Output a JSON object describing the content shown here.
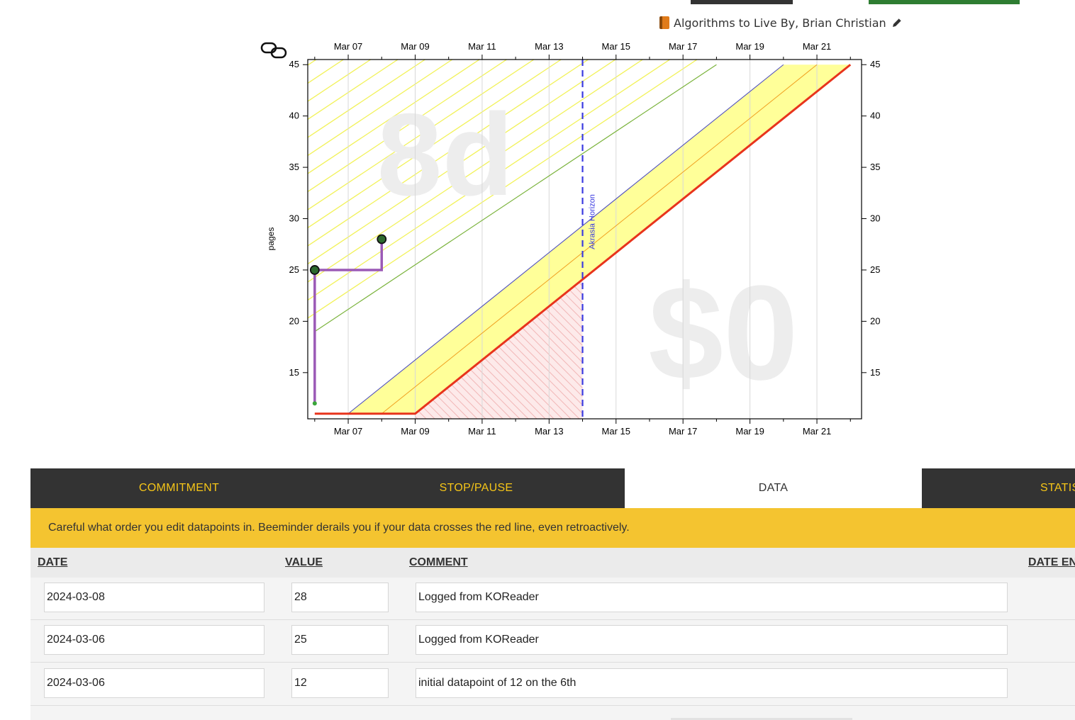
{
  "goal": {
    "book_icon": "book-icon",
    "title": "Algorithms to Live By, Brian Christian",
    "edit_icon": "pencil-icon"
  },
  "graph_controls": {
    "link_icon": "link-icon"
  },
  "chart_data": {
    "type": "line",
    "ylabel": "pages",
    "x_ticks": [
      "Mar 07",
      "Mar 09",
      "Mar 11",
      "Mar 13",
      "Mar 15",
      "Mar 17",
      "Mar 19",
      "Mar 21"
    ],
    "x_tick_dates": [
      "2024-03-07",
      "2024-03-09",
      "2024-03-11",
      "2024-03-13",
      "2024-03-15",
      "2024-03-17",
      "2024-03-19",
      "2024-03-21"
    ],
    "xlim": [
      "2024-03-05T19:00",
      "2024-03-22T08:00"
    ],
    "y_ticks": [
      15,
      20,
      25,
      30,
      35,
      40,
      45
    ],
    "ylim": [
      10.5,
      45.5
    ],
    "watermark_days": "8d",
    "watermark_pledge": "$0",
    "akrasia_horizon": {
      "label": "Akrasia Horizon",
      "date": "2024-03-14"
    },
    "bright_red_line": {
      "x": [
        "2024-03-06",
        "2024-03-09",
        "2024-03-22"
      ],
      "y": [
        11,
        11,
        45
      ]
    },
    "safe_line": {
      "x": [
        "2024-03-07",
        "2024-03-20"
      ],
      "y": [
        11,
        45
      ]
    },
    "green_line": {
      "x": [
        "2024-03-06",
        "2024-03-18"
      ],
      "y": [
        19,
        45
      ]
    },
    "datapoints": {
      "x": [
        "2024-03-06",
        "2024-03-06",
        "2024-03-08"
      ],
      "y": [
        12,
        25,
        28
      ]
    }
  },
  "tabs": [
    {
      "label": "COMMITMENT"
    },
    {
      "label": "STOP/PAUSE"
    },
    {
      "label": "DATA"
    },
    {
      "label": "STATIS"
    }
  ],
  "warning": {
    "text": "Careful what order you edit datapoints in. Beeminder derails you if your data crosses the red line, even retroactively."
  },
  "table": {
    "headers": {
      "date": "DATE",
      "value": "VALUE",
      "comment": "COMMENT",
      "date_entered": "DATE EN"
    },
    "rows": [
      {
        "date": "2024-03-08",
        "value": "28",
        "comment": "Logged from KOReader"
      },
      {
        "date": "2024-03-06",
        "value": "25",
        "comment": "Logged from KOReader"
      },
      {
        "date": "2024-03-06",
        "value": "12",
        "comment": "initial datapoint of 12 on the 6th"
      }
    ]
  },
  "colors": {
    "dark": "#333333",
    "accent_yellow": "#f4c430",
    "tab_text": "#f5c518",
    "road_yellow": "#ffff99",
    "red_line": "#e8341c",
    "purple_data": "#9b59b6",
    "green_line": "#7ab33b",
    "blue_line": "#5050c0",
    "akrasia_blue": "#3a3ae0"
  }
}
